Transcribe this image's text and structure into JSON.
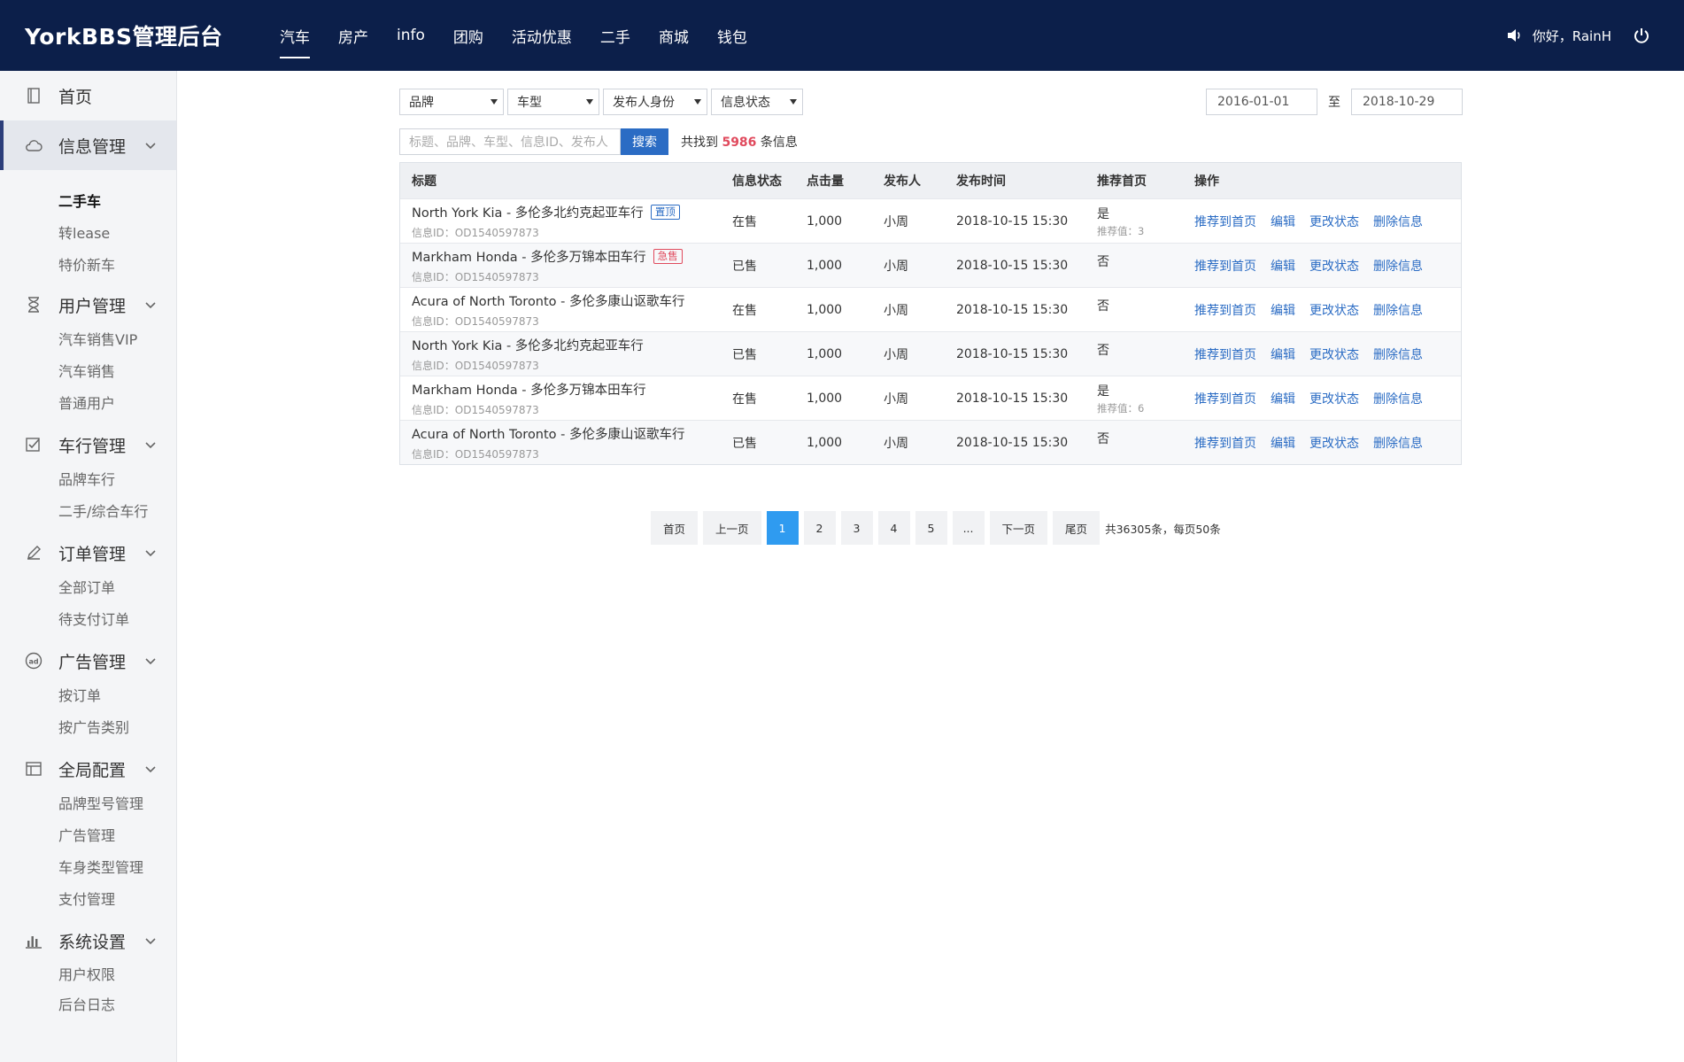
{
  "header": {
    "logo": "YorkBBS管理后台",
    "nav": [
      "汽车",
      "房产",
      "info",
      "团购",
      "活动优惠",
      "二手",
      "商城",
      "钱包"
    ],
    "active_nav": "汽车",
    "greeting": "你好，RainH"
  },
  "sidebar": {
    "home": "首页",
    "groups": [
      {
        "label": "信息管理",
        "icon": "cloud-icon",
        "items": [
          "二手车",
          "转lease",
          "特价新车"
        ],
        "active_item": "二手车"
      },
      {
        "label": "用户管理",
        "icon": "hourglass-icon",
        "items": [
          "汽车销售VIP",
          "汽车销售",
          "普通用户"
        ]
      },
      {
        "label": "车行管理",
        "icon": "checkbox-icon",
        "items": [
          "品牌车行",
          "二手/综合车行"
        ]
      },
      {
        "label": "订单管理",
        "icon": "pencil-icon",
        "items": [
          "全部订单",
          "待支付订单"
        ]
      },
      {
        "label": "广告管理",
        "icon": "ad-icon",
        "items": [
          "按订单",
          "按广告类别"
        ]
      },
      {
        "label": "全局配置",
        "icon": "layout-icon",
        "items": [
          "品牌型号管理",
          "广告管理",
          "车身类型管理",
          "支付管理"
        ]
      },
      {
        "label": "系统设置",
        "icon": "bar-chart-icon",
        "items": [
          "用户权限",
          "后台日志"
        ]
      }
    ]
  },
  "filters": {
    "selects": [
      "品牌",
      "车型",
      "发布人身份",
      "信息状态"
    ],
    "date_from": "2016-01-01",
    "date_sep": "至",
    "date_to": "2018-10-29"
  },
  "search": {
    "placeholder": "标题、品牌、车型、信息ID、发布人",
    "button": "搜索",
    "result_prefix": "共找到",
    "result_count": "5986",
    "result_suffix": "条信息"
  },
  "table": {
    "headers": [
      "标题",
      "信息状态",
      "点击量",
      "发布人",
      "发布时间",
      "推荐首页",
      "操作"
    ],
    "ops": [
      "推荐到首页",
      "编辑",
      "更改状态",
      "删除信息"
    ],
    "rows": [
      {
        "title": "North York Kia - 多伦多北约克起亚车行",
        "tag": "置顶",
        "tag_color": "#2b6cc4",
        "id": "信息ID：OD1540597873",
        "status": "在售",
        "clicks": "1,000",
        "publisher": "小周",
        "time": "2018-10-15 15:30",
        "rec": "是",
        "rec_value": "推荐值：3"
      },
      {
        "title": "Markham Honda - 多伦多万锦本田车行",
        "tag": "急售",
        "tag_color": "#e04a5d",
        "id": "信息ID：OD1540597873",
        "status": "已售",
        "clicks": "1,000",
        "publisher": "小周",
        "time": "2018-10-15 15:30",
        "rec": "否",
        "rec_value": ""
      },
      {
        "title": "Acura of North Toronto - 多伦多康山讴歌车行",
        "tag": "",
        "tag_color": "",
        "id": "信息ID：OD1540597873",
        "status": "在售",
        "clicks": "1,000",
        "publisher": "小周",
        "time": "2018-10-15 15:30",
        "rec": "否",
        "rec_value": ""
      },
      {
        "title": "North York Kia - 多伦多北约克起亚车行",
        "tag": "",
        "tag_color": "",
        "id": "信息ID：OD1540597873",
        "status": "已售",
        "clicks": "1,000",
        "publisher": "小周",
        "time": "2018-10-15 15:30",
        "rec": "否",
        "rec_value": ""
      },
      {
        "title": "Markham Honda - 多伦多万锦本田车行",
        "tag": "",
        "tag_color": "",
        "id": "信息ID：OD1540597873",
        "status": "在售",
        "clicks": "1,000",
        "publisher": "小周",
        "time": "2018-10-15 15:30",
        "rec": "是",
        "rec_value": "推荐值：6"
      },
      {
        "title": "Acura of North Toronto - 多伦多康山讴歌车行",
        "tag": "",
        "tag_color": "",
        "id": "信息ID：OD1540597873",
        "status": "已售",
        "clicks": "1,000",
        "publisher": "小周",
        "time": "2018-10-15 15:30",
        "rec": "否",
        "rec_value": ""
      }
    ]
  },
  "pagination": {
    "first": "首页",
    "prev": "上一页",
    "pages": [
      "1",
      "2",
      "3",
      "4",
      "5"
    ],
    "active_page": "1",
    "ellipsis": "...",
    "next": "下一页",
    "last": "尾页",
    "summary": "共36305条，每页50条"
  },
  "colors": {
    "header_bg": "#0c1f4a",
    "link": "#2b6cc4",
    "highlight": "#e04a5d",
    "active_page": "#2f9bf0"
  }
}
